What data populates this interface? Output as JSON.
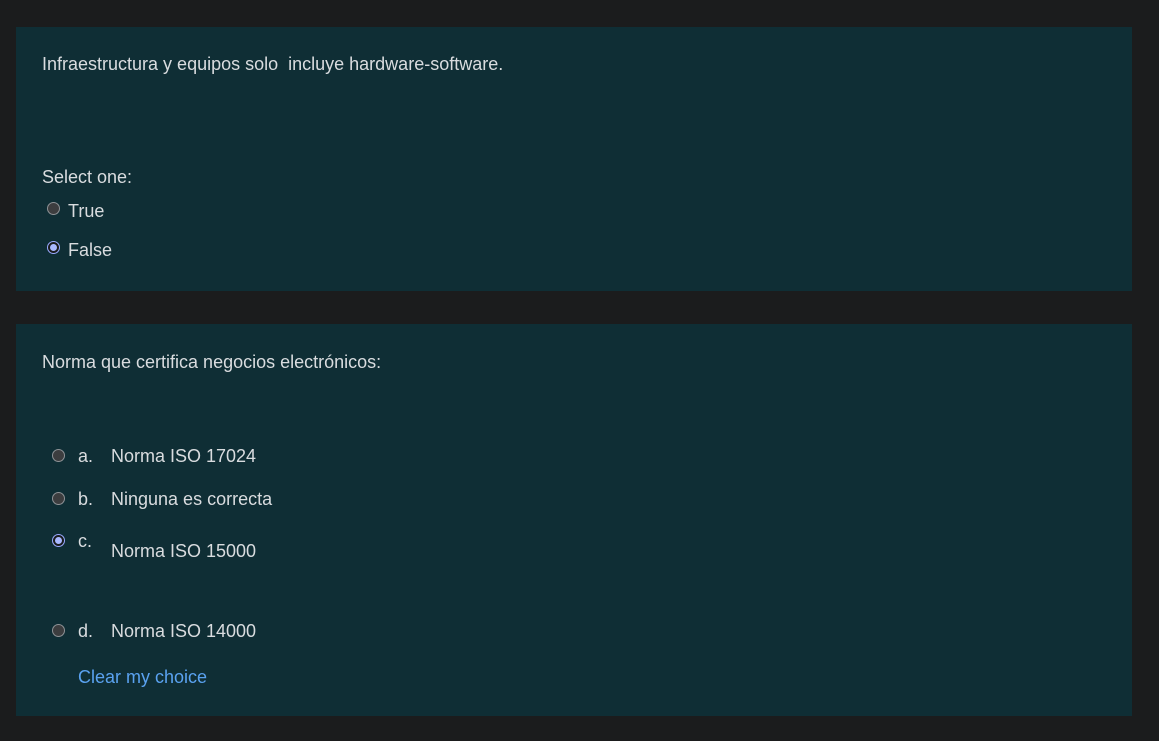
{
  "question1": {
    "text": "Infraestructura y equipos solo  incluye hardware-software.",
    "prompt": "Select one:",
    "options": [
      {
        "label": "True",
        "selected": false
      },
      {
        "label": "False",
        "selected": true
      }
    ]
  },
  "question2": {
    "text": "Norma que certifica negocios electrónicos:",
    "options": [
      {
        "letter": "a.",
        "label": "Norma ISO 17024",
        "selected": false
      },
      {
        "letter": "b.",
        "label": "Ninguna es correcta",
        "selected": false
      },
      {
        "letter": "c.",
        "label": "Norma ISO 15000",
        "selected": true
      },
      {
        "letter": "d.",
        "label": "Norma ISO 14000",
        "selected": false
      }
    ],
    "clear_label": "Clear my choice"
  },
  "colors": {
    "page_bg": "#1b1c1d",
    "card_bg": "#0f2e35",
    "text": "#d9dcdf",
    "link": "#5aa2f0",
    "radio_checked": "#a8b8ff"
  }
}
